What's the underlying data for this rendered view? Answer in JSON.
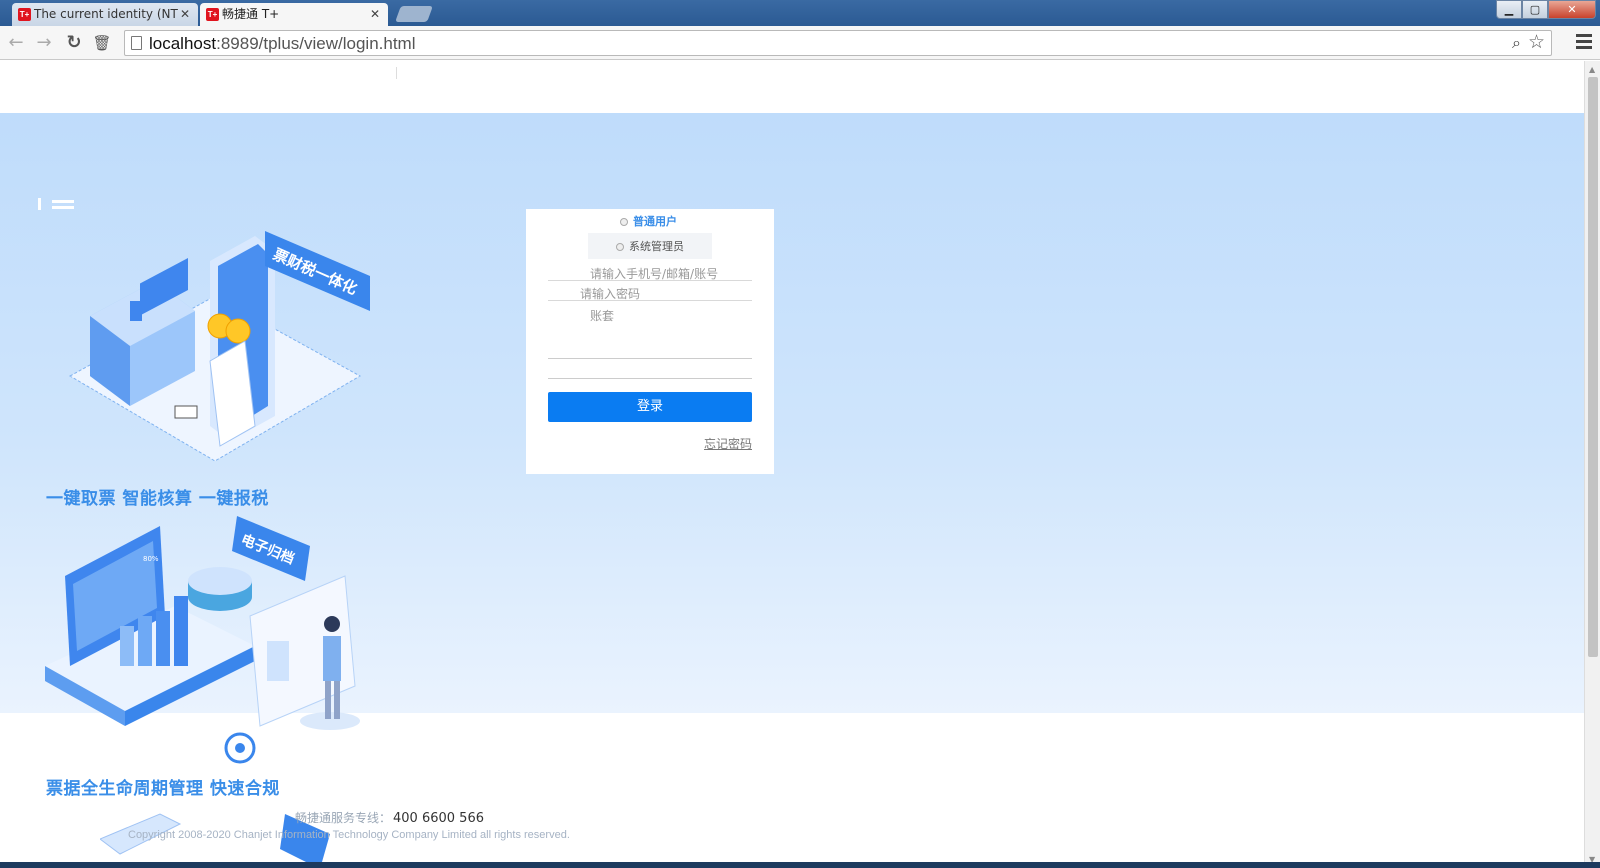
{
  "browser": {
    "tabs": [
      {
        "title": "The current identity (NT",
        "favicon": "T+"
      },
      {
        "title": "畅捷通 T+",
        "favicon": "T+"
      }
    ],
    "url_host": "localhost",
    "url_rest": ":8989/tplus/view/login.html",
    "controls": {
      "minimize": "▁",
      "maximize": "▢",
      "close": "✕",
      "back": "←",
      "forward": "→",
      "reload": "↻",
      "delete": "🗑"
    }
  },
  "colors": {
    "accent": "#0a7cf2",
    "slogan": "#3a8ee8",
    "hero_top": "#bfdcfb"
  },
  "hero": {
    "slogan1": "一键取票 智能核算 一键报税",
    "slogan2": "票据全生命周期管理 快速合规",
    "banner1": "票财税一体化",
    "banner2": "电子归档",
    "chart_label": "80%"
  },
  "login": {
    "role_user": "普通用户",
    "role_admin": "系统管理员",
    "account_placeholder": "请输入手机号/邮箱/账号",
    "password_placeholder": "请输入密码",
    "book_label": "账套",
    "login_button": "登录",
    "forgot_password": "忘记密码"
  },
  "footer": {
    "hotline_label": "畅捷通服务专线：",
    "hotline_number": "400 6600 566",
    "copyright": "Copyright 2008-2020 Chanjet Information Technology Company Limited all rights reserved."
  }
}
